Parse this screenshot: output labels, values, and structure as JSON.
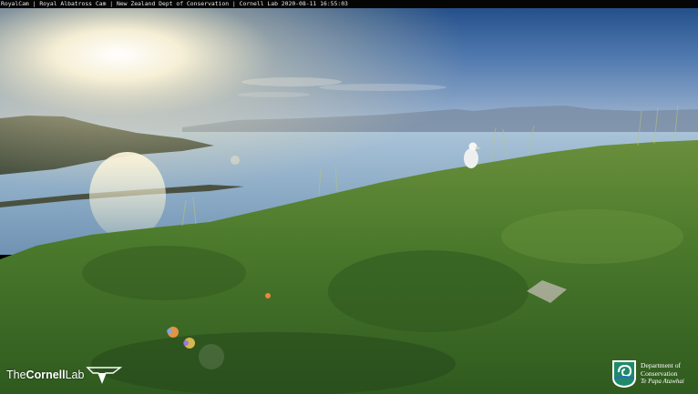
{
  "caption": "RoyalCam | Royal Albatross Cam | New Zealand Dept of Conservation | Cornell Lab 2020-08-11 16:55:03",
  "cornell_logo": {
    "the": "The",
    "cornell": "Cornell",
    "lab": "Lab"
  },
  "doc_logo": {
    "line1": "Department of",
    "line2": "Conservation",
    "line3": "Te Papa Atawhai"
  },
  "colors": {
    "sky_top": "#2f5a8f",
    "sun": "#fff8e0",
    "sea": "#8fb3cf",
    "grass": "#4f7a30"
  }
}
